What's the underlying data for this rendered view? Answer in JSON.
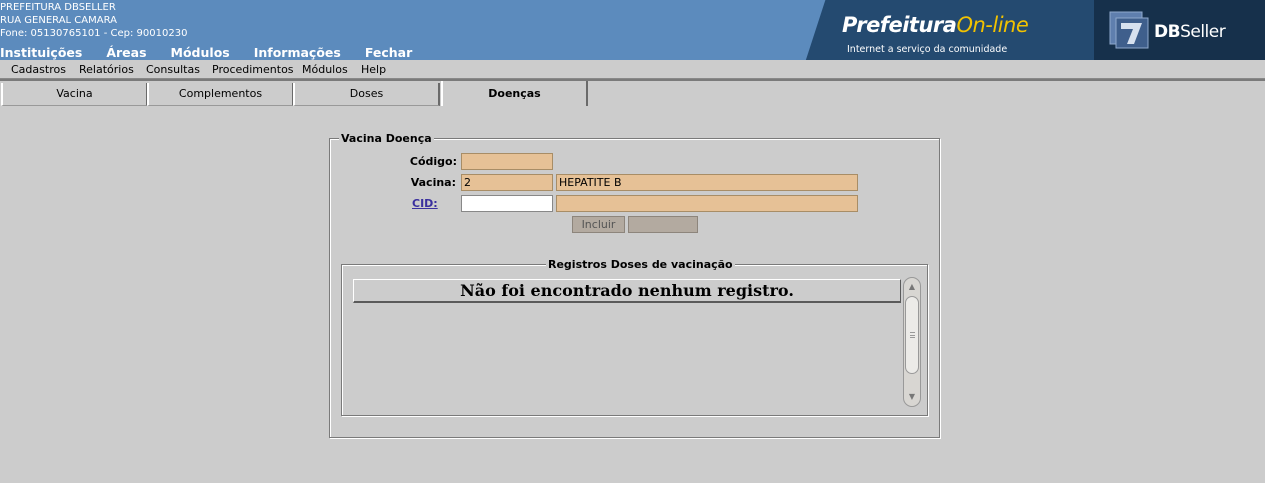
{
  "header": {
    "org_name": "PREFEITURA DBSELLER",
    "address": "RUA GENERAL CAMARA",
    "contact": "Fone: 05130765101  -  Cep: 90010230",
    "nav": [
      "Instituições",
      "Áreas",
      "Módulos",
      "Informações",
      "Fechar"
    ],
    "logo_title_main": "Prefeitura",
    "logo_title_accent": "On-line",
    "logo_subtitle": "Internet a serviço da comunidade",
    "brand_bold": "DB",
    "brand_rest": "Seller"
  },
  "menu": [
    "Cadastros",
    "Relatórios",
    "Consultas",
    "Procedimentos",
    "Módulos",
    "Help"
  ],
  "tabs": [
    "Vacina",
    "Complementos",
    "Doses",
    "Doenças"
  ],
  "active_tab": "Doenças",
  "form": {
    "legend": "Vacina Doença",
    "codigo_label": "Código:",
    "codigo_value": "",
    "vacina_label": "Vacina:",
    "vacina_code": "2",
    "vacina_name": "HEPATITE B",
    "cid_label": "CID:",
    "cid_code": "",
    "cid_description": "",
    "incluir_label": "Incluir",
    "second_button_label": ""
  },
  "grid": {
    "legend": "Registros Doses de vacinação",
    "empty_message": "Não foi encontrado nenhum registro."
  },
  "colors": {
    "banner": "#5c8bbd",
    "readonly_field": "#e6c196",
    "background": "#cccccc"
  }
}
